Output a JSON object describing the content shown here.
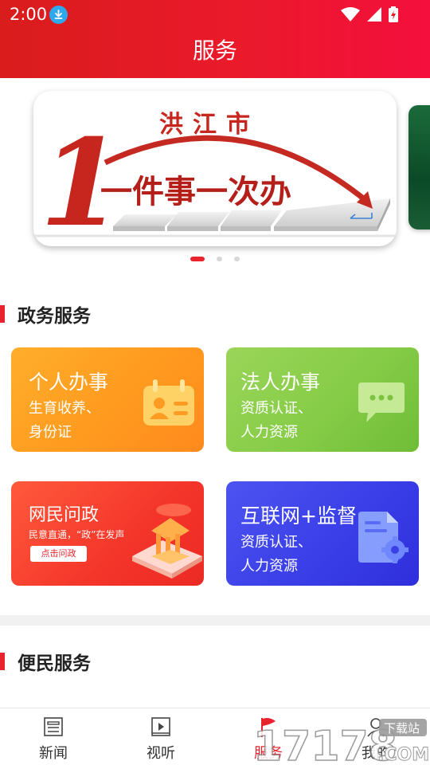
{
  "status": {
    "time": "2:00"
  },
  "header": {
    "title": "服务"
  },
  "banner": {
    "city": "洪江市",
    "numeral": "1",
    "slogan": "一件事一次办",
    "active_index": 0,
    "count": 3
  },
  "colors": {
    "brand_red": "#e8232e",
    "card_personal": "#ff9a1f",
    "card_legal": "#86cc47",
    "card_netizen": "#f4352a",
    "card_internet": "#3a3fe8"
  },
  "gov_section": {
    "title": "政务服务",
    "cards": [
      {
        "title": "个人办事",
        "subtitle": "生育收养、身份证",
        "icon": "id-card-icon"
      },
      {
        "title": "法人办事",
        "subtitle": "资质认证、人力资源",
        "icon": "chat-bubble-icon"
      },
      {
        "title": "网民问政",
        "subtitle": "民意直通，“政”在发声",
        "button": "点击问政",
        "icon": "government-building-icon"
      },
      {
        "title": "互联网+监督",
        "subtitle": "资质认证、人力资源",
        "icon": "document-gear-icon"
      }
    ]
  },
  "convenience_section": {
    "title": "便民服务"
  },
  "bottom_nav": {
    "items": [
      {
        "label": "新闻",
        "icon": "news-icon"
      },
      {
        "label": "视听",
        "icon": "video-icon"
      },
      {
        "label": "服务",
        "icon": "flag-icon"
      },
      {
        "label": "我的",
        "icon": "profile-icon"
      }
    ],
    "active": "服务"
  },
  "watermark": {
    "number": "17178",
    "tag": "下载站",
    "domain": ".COM"
  }
}
